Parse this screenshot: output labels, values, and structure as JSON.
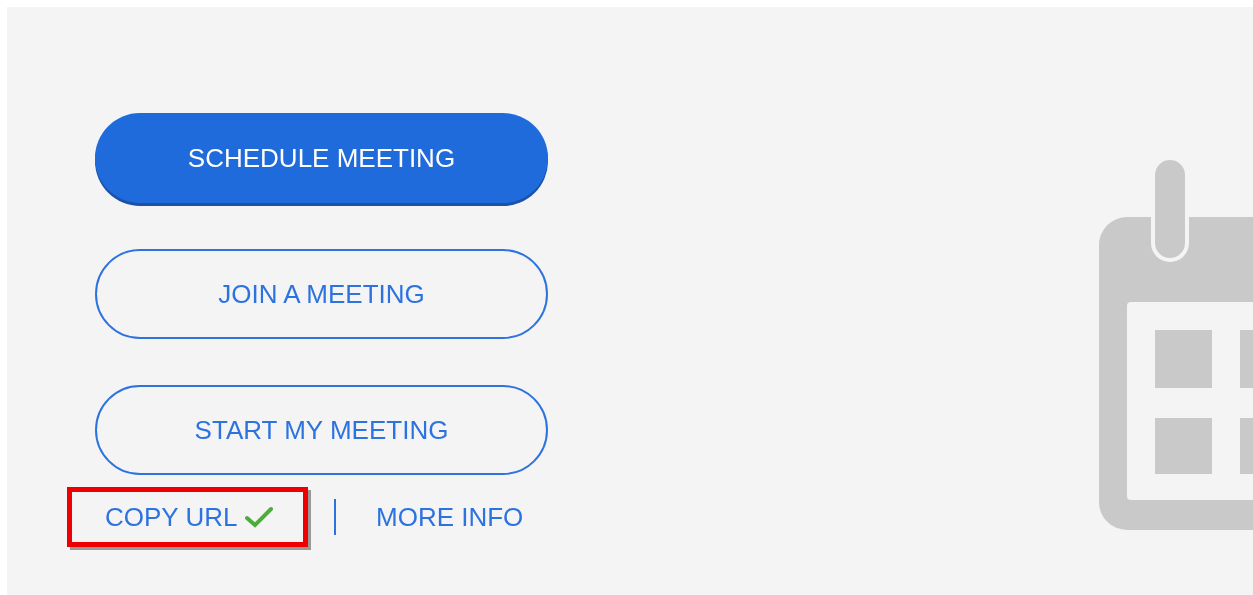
{
  "buttons": [
    {
      "label": "SCHEDULE MEETING",
      "kind": "primary"
    },
    {
      "label": "JOIN A MEETING",
      "kind": "outline"
    },
    {
      "label": "START MY MEETING",
      "kind": "outline"
    }
  ],
  "links": {
    "copy_url": {
      "label": "COPY URL",
      "copied": true,
      "highlighted": true
    },
    "more_info": {
      "label": "MORE INFO"
    }
  }
}
